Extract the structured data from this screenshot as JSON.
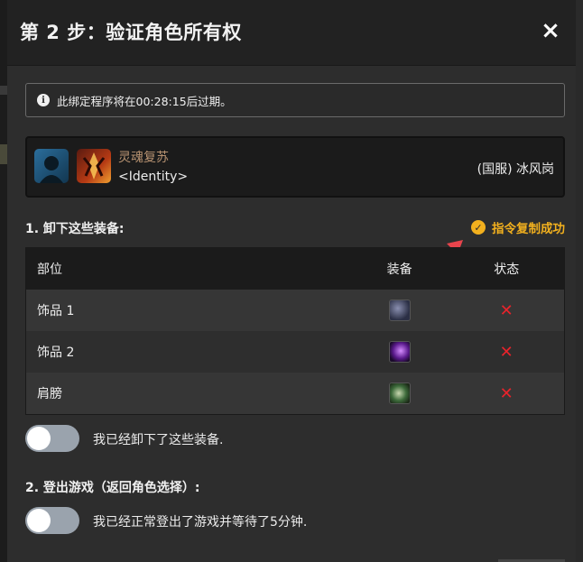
{
  "dialog": {
    "title": "第 2 步：验证角色所有权",
    "close_label": "×"
  },
  "alert": {
    "icon": "info-icon",
    "text": "此绑定程序将在00:28:15后过期。"
  },
  "character": {
    "name": "灵魂复苏",
    "guild": "<Identity>",
    "realm": "(国服) 冰风岗"
  },
  "step1": {
    "title": "1. 卸下这些装备:",
    "copy_status": "指令复制成功",
    "table": {
      "headers": [
        "部位",
        "装备",
        "状态"
      ],
      "rows": [
        {
          "slot": "饰品 1",
          "item_icon": "trinket-icon",
          "status": "✕"
        },
        {
          "slot": "饰品 2",
          "item_icon": "trinket-icon",
          "status": "✕"
        },
        {
          "slot": "肩膀",
          "item_icon": "shoulder-icon",
          "status": "✕"
        }
      ]
    },
    "confirm_label": "我已经卸下了这些装备."
  },
  "step2": {
    "title": "2. 登出游戏（返回角色选择）:",
    "confirm_label": "我已经正常登出了游戏并等待了5分钟."
  },
  "colors": {
    "accent": "#f2b01e",
    "error": "#e8232b",
    "character_name": "#b79271",
    "arrow": "#e8444c"
  }
}
